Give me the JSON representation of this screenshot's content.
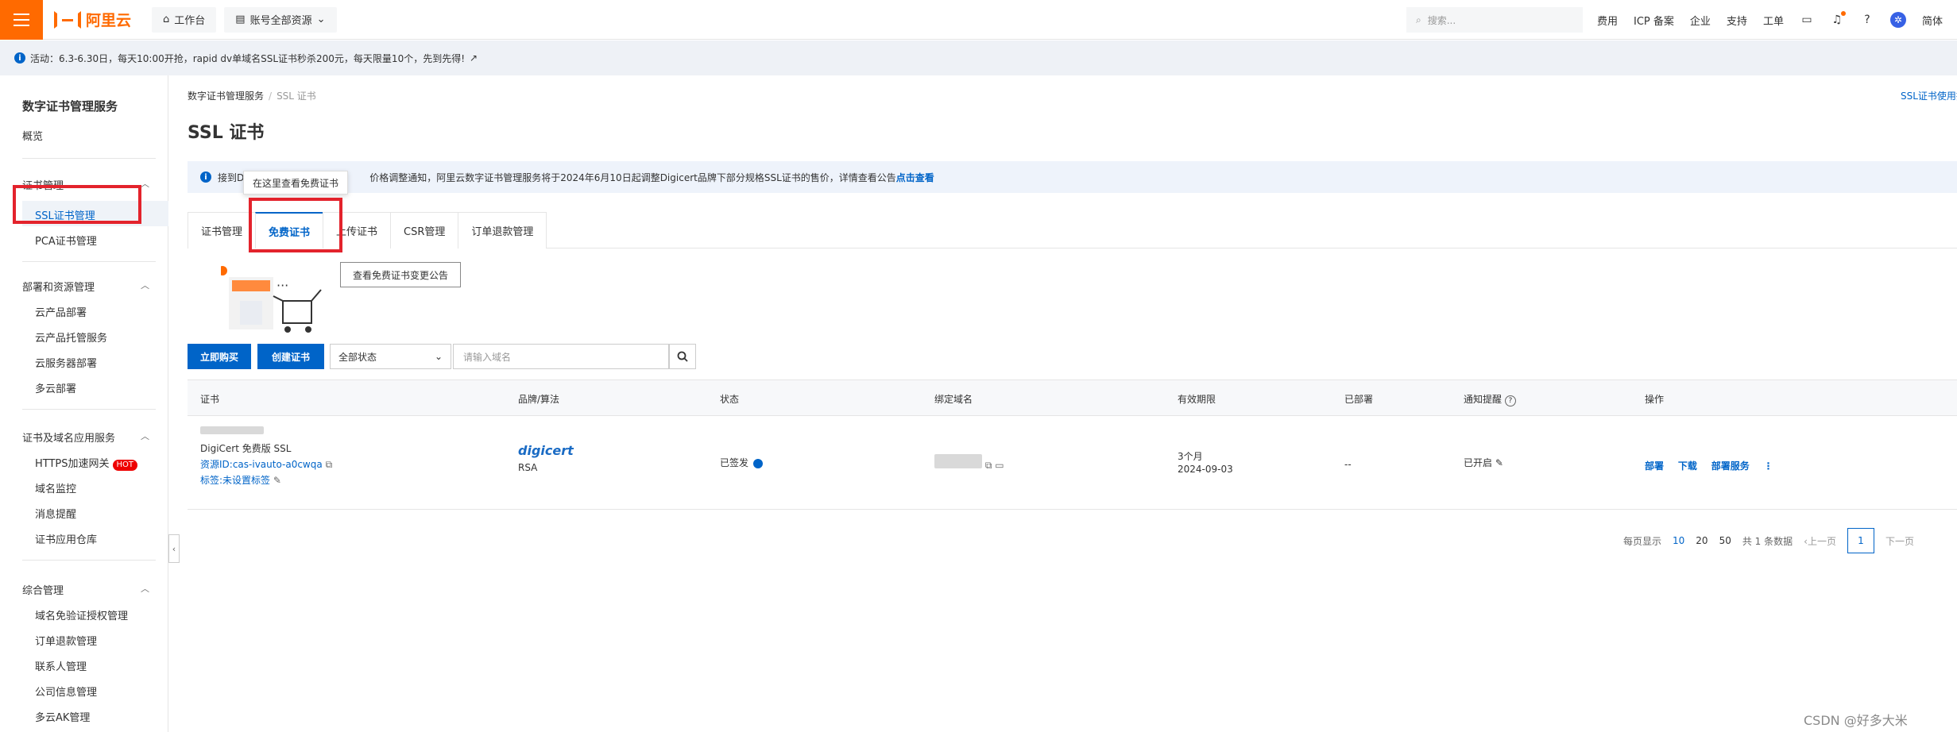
{
  "topbar": {
    "logo_text": "阿里云",
    "workbench": "工作台",
    "resources": "账号全部资源",
    "search_placeholder": "搜索...",
    "links": [
      "费用",
      "ICP 备案",
      "企业",
      "支持",
      "工单"
    ],
    "lang": "简体"
  },
  "announcement": "活动：6.3-6.30日，每天10:00开抢，rapid dv单域名SSL证书秒杀200元，每天限量10个，先到先得!",
  "sidebar": {
    "title": "数字证书管理服务",
    "overview": "概览",
    "groups": [
      {
        "label": "证书管理",
        "items": [
          "SSL证书管理",
          "PCA证书管理"
        ]
      },
      {
        "label": "部署和资源管理",
        "items": [
          "云产品部署",
          "云产品托管服务",
          "云服务器部署",
          "多云部署"
        ]
      },
      {
        "label": "证书及域名应用服务",
        "items": [
          "HTTPS加速网关",
          "域名监控",
          "消息提醒",
          "证书应用仓库"
        ]
      },
      {
        "label": "综合管理",
        "items": [
          "域名免验证授权管理",
          "订单退款管理",
          "联系人管理",
          "公司信息管理",
          "多云AK管理"
        ]
      }
    ],
    "hot_badge": "HOT"
  },
  "main": {
    "breadcrumb": [
      "数字证书管理服务",
      "SSL 证书"
    ],
    "right_link": "SSL证书使用指南",
    "title": "SSL 证书",
    "notice_prefix": "接到D",
    "notice_text": "价格调整通知，阿里云数字证书管理服务将于2024年6月10日起调整Digicert品牌下部分规格SSL证书的售价，详情查看公告",
    "notice_link": "点击查看",
    "tooltip": "在这里查看免费证书",
    "tabs": [
      "证书管理",
      "免费证书",
      "上传证书",
      "CSR管理",
      "订单退款管理"
    ],
    "announce_btn": "查看免费证书变更公告",
    "buy_btn": "立即购买",
    "create_btn": "创建证书",
    "status_select": "全部状态",
    "domain_placeholder": "请输入域名"
  },
  "table": {
    "headers": [
      "证书",
      "品牌/算法",
      "状态",
      "绑定域名",
      "有效期限",
      "已部署",
      "通知提醒",
      "操作"
    ],
    "row": {
      "cert_type": "DigiCert 免费版 SSL",
      "resource_id": "资源ID:cas-ivauto-a0cwqa",
      "tag": "标签:未设置标签",
      "brand": "digicert",
      "algo": "RSA",
      "status": "已签发",
      "validity": "3个月",
      "expiry": "2024-09-03",
      "deployed": "--",
      "notify": "已开启",
      "ops": [
        "部署",
        "下载",
        "部署服务"
      ]
    }
  },
  "pager": {
    "per_page_label": "每页显示",
    "sizes": [
      "10",
      "20",
      "50"
    ],
    "total": "共 1 条数据",
    "prev": "上一页",
    "current": "1",
    "next": "下一页"
  },
  "watermark": "CSDN @好多大米"
}
